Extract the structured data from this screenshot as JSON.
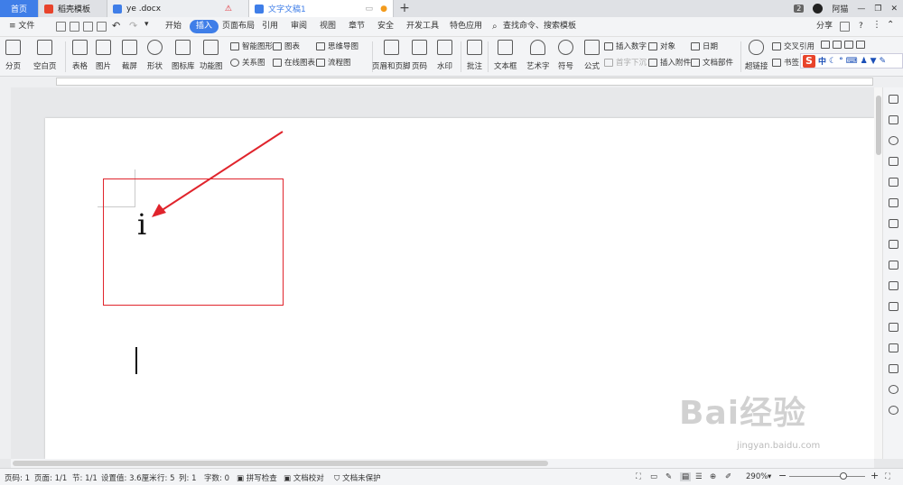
{
  "tabs": {
    "home": "首页",
    "template": "稻壳模板",
    "file1": "ye .docx",
    "file2": "文字文稿1",
    "add": "+"
  },
  "window": {
    "badge": "2",
    "user": "阿猫",
    "minimize": "—",
    "restore": "❐",
    "close": "✕"
  },
  "menu": {
    "file": "≡ 文件",
    "items": [
      "开始",
      "插入",
      "页面布局",
      "引用",
      "审阅",
      "视图",
      "章节",
      "安全",
      "开发工具",
      "特色应用"
    ],
    "search": "查找命令、搜索模板",
    "share": "分享",
    "help": "?"
  },
  "ribbon": {
    "big": [
      "分页",
      "空白页",
      "表格",
      "图片",
      "截屏",
      "形状",
      "图标库",
      "功能图",
      "页眉和页脚",
      "页码",
      "水印",
      "批注",
      "文本框",
      "艺术字",
      "符号",
      "公式",
      "超链接",
      "书签"
    ],
    "small": {
      "smart_graphic": "智能图形",
      "chart": "图表",
      "mind_map": "思维导图",
      "relation": "关系图",
      "online_chart": "在线图表",
      "flow": "流程图",
      "insert_number": "插入数字",
      "object": "对象",
      "date": "日期",
      "cross_ref": "交叉引用",
      "first_drop": "首字下沉",
      "attach": "插入附件",
      "doc_parts": "文档部件"
    }
  },
  "ime": {
    "logo": "S",
    "lang": "中"
  },
  "document": {
    "char": "i"
  },
  "status": {
    "page_no": "页码: 1",
    "pages": "页面: 1/1",
    "section": "节: 1/1",
    "position": "设置值: 3.6厘米",
    "row": "行: 5",
    "col": "列: 1",
    "words": "字数: 0",
    "spell": "拼写检查",
    "proof": "文档校对",
    "protect": "文档未保护",
    "zoom": "290%"
  },
  "watermark": {
    "main": "Bai经验",
    "sub": "jingyan.baidu.com"
  },
  "colors": {
    "accent": "#3f7ee8",
    "annotation": "#e0242c"
  }
}
